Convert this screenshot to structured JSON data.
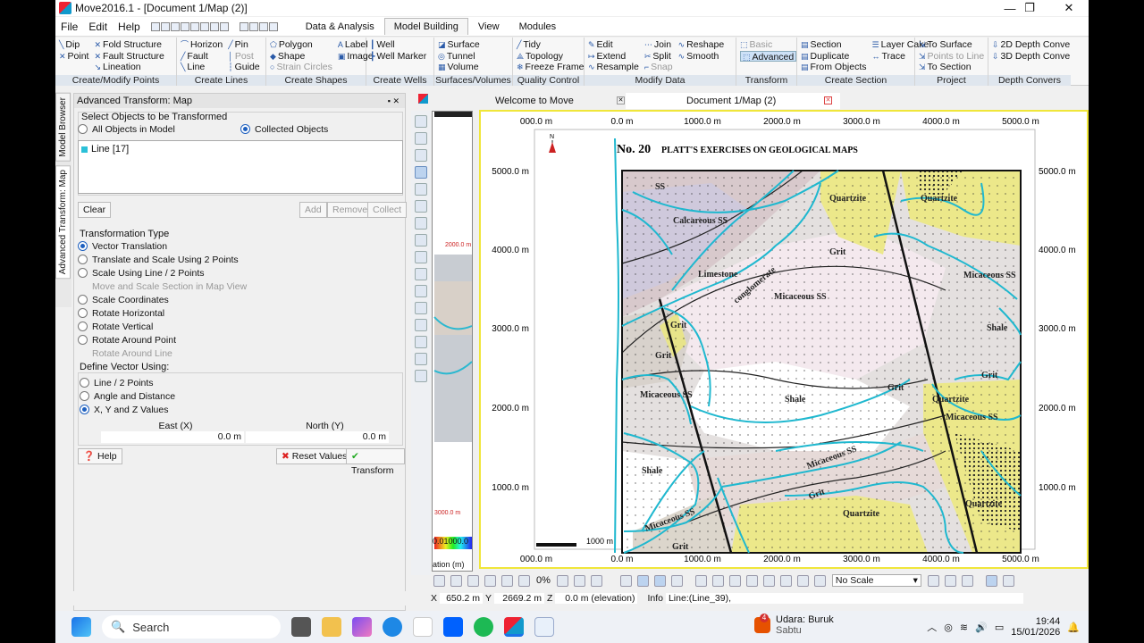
{
  "window": {
    "title": "Move2016.1 - [Document 1/Map (2)]",
    "minimize": "—",
    "maximize": "❐",
    "close": "✕"
  },
  "menu": [
    "File",
    "Edit",
    "Help"
  ],
  "ribbon_tabs": [
    {
      "label": "Data & Analysis"
    },
    {
      "label": "Model Building",
      "active": true
    },
    {
      "label": "View"
    },
    {
      "label": "Modules"
    }
  ],
  "ribbon": {
    "create_modify_points": {
      "label": "Create/Modify Points",
      "items": [
        "Dip",
        "Point",
        "Fold Structure",
        "Fault Structure",
        "Lineation"
      ]
    },
    "create_lines": {
      "label": "Create Lines",
      "items": [
        "Horizon",
        "Fault",
        "Line",
        "Pin",
        "Post",
        "Guide"
      ]
    },
    "create_shapes": {
      "label": "Create Shapes",
      "items": [
        "Polygon",
        "Shape",
        "Strain Circles",
        "Label",
        "Image"
      ]
    },
    "create_wells": {
      "label": "Create Wells",
      "items": [
        "Well",
        "Well Marker"
      ]
    },
    "surfaces_volumes": {
      "label": "Surfaces/Volumes",
      "items": [
        "Surface",
        "Tunnel",
        "Volume"
      ]
    },
    "quality_control": {
      "label": "Quality Control",
      "items": [
        "Tidy",
        "Topology",
        "Freeze Frame"
      ]
    },
    "modify_data": {
      "label": "Modify Data",
      "items": [
        "Edit",
        "Extend",
        "Resample",
        "Join",
        "Split",
        "Snap",
        "Reshape",
        "Smooth"
      ]
    },
    "transform": {
      "label": "Transform",
      "items": [
        "Basic",
        "Advanced"
      ]
    },
    "create_section": {
      "label": "Create Section",
      "items": [
        "Section",
        "Duplicate",
        "From Objects",
        "Layer Cake",
        "Trace"
      ]
    },
    "project": {
      "label": "Project",
      "items": [
        "To Surface",
        "Points to Line",
        "To Section"
      ]
    },
    "depth_conv": {
      "label": "Depth Convers",
      "items": [
        "2D Depth Conve",
        "3D Depth Conve"
      ]
    }
  },
  "side_tabs": [
    "Model Browser",
    "Advanced Transform: Map"
  ],
  "panel": {
    "title": "Advanced Transform: Map",
    "select_heading": "Select Objects to be Transformed",
    "opt_all": "All Objects in Model",
    "opt_collected": "Collected Objects",
    "list_items": [
      "Line [17]"
    ],
    "btn_clear": "Clear",
    "btn_add": "Add",
    "btn_remove": "Remove",
    "btn_collect": "Collect",
    "type_heading": "Transformation Type",
    "types": [
      {
        "label": "Vector Translation",
        "on": true
      },
      {
        "label": "Translate and Scale Using 2 Points"
      },
      {
        "label": "Scale Using Line / 2 Points"
      },
      {
        "label": "Move and Scale Section in Map View",
        "dis": true
      },
      {
        "label": "Scale Coordinates"
      },
      {
        "label": "Rotate Horizontal"
      },
      {
        "label": "Rotate Vertical"
      },
      {
        "label": "Rotate Around Point"
      },
      {
        "label": "Rotate Around Line",
        "dis": true
      }
    ],
    "vector_heading": "Define Vector Using:",
    "vector_opts": [
      {
        "label": "Line / 2 Points"
      },
      {
        "label": "Angle and Distance"
      },
      {
        "label": "X, Y and Z Values",
        "on": true
      }
    ],
    "east_label": "East (X)",
    "north_label": "North (Y)",
    "east_val": "0.0 m",
    "north_val": "0.0 m",
    "btn_help": "Help",
    "btn_reset": "Reset Values",
    "btn_transform": "Transform"
  },
  "doc_tabs": {
    "welcome": "Welcome to Move",
    "doc": "Document 1/Map (2)"
  },
  "minimap": {
    "label_top": "2000.0 m",
    "label_bot": "3000.0 m",
    "scale": "0.01000.0",
    "elev": "ation (m)"
  },
  "map": {
    "x_ticks": [
      "000.0 m",
      "0.0 m",
      "1000.0 m",
      "2000.0 m",
      "3000.0 m",
      "4000.0 m",
      "5000.0 m"
    ],
    "y_ticks": [
      "5000.0 m",
      "4000.0 m",
      "3000.0 m",
      "2000.0 m",
      "1000.0 m"
    ],
    "y_ticks_right": [
      "5000.0 m",
      "4000.0 m",
      "3000.0 m",
      "2000.0 m",
      "1000.0 m"
    ],
    "north": "N",
    "heading": "No. 20",
    "subheading": "PLATT'S EXERCISES ON GEOLOGICAL MAPS",
    "scale_label": "1000 m",
    "units": [
      "SS",
      "Calcareous SS",
      "Limestone",
      "conglomerate",
      "Micaceous SS",
      "Grit",
      "Grit",
      "Quartzite",
      "Quartzite",
      "Grit",
      "Micaceous SS",
      "Shale",
      "Micaceous SS",
      "Shale",
      "Grit",
      "Quartzite",
      "Shale",
      "Micaceous SS",
      "Grit",
      "Quartzite",
      "Micaceous SS",
      "Grit",
      "Quartzite",
      "Grit",
      "Micaceous SS"
    ]
  },
  "bottom_toolbar": {
    "zoom": "0%",
    "scale_mode": "No Scale"
  },
  "status": {
    "x_label": "X",
    "x_val": "650.2 m",
    "y_label": "Y",
    "y_val": "2669.2 m",
    "z_label": "Z",
    "z_val": "0.0 m (elevation)",
    "info_label": "Info",
    "info_val": "Line:(Line_39),"
  },
  "taskbar": {
    "search": "Search",
    "weather_title": "Udara: Buruk",
    "weather_sub": "Sabtu",
    "badge": "4",
    "time": "19:44",
    "date": "15/01/2026"
  }
}
